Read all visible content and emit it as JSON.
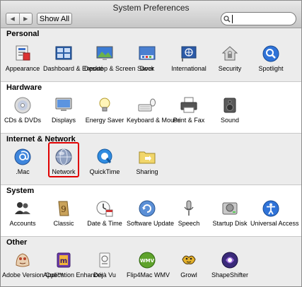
{
  "window": {
    "title": "System Preferences"
  },
  "toolbar": {
    "back_icon": "back-arrow-icon",
    "forward_icon": "forward-arrow-icon",
    "show_all_label": "Show All",
    "search_placeholder": ""
  },
  "sections": [
    {
      "title": "Personal",
      "items": [
        {
          "label": "Appearance",
          "icon": "appearance-icon"
        },
        {
          "label": "Dashboard & Exposé",
          "icon": "dashboard-icon"
        },
        {
          "label": "Desktop & Screen Saver",
          "icon": "desktop-icon"
        },
        {
          "label": "Dock",
          "icon": "dock-icon"
        },
        {
          "label": "International",
          "icon": "globe-flag-icon"
        },
        {
          "label": "Security",
          "icon": "house-lock-icon"
        },
        {
          "label": "Spotlight",
          "icon": "magnifier-icon"
        }
      ]
    },
    {
      "title": "Hardware",
      "items": [
        {
          "label": "CDs & DVDs",
          "icon": "disc-icon"
        },
        {
          "label": "Displays",
          "icon": "monitor-icon"
        },
        {
          "label": "Energy Saver",
          "icon": "lightbulb-icon"
        },
        {
          "label": "Keyboard & Mouse",
          "icon": "keyboard-icon"
        },
        {
          "label": "Print & Fax",
          "icon": "printer-icon"
        },
        {
          "label": "Sound",
          "icon": "speaker-icon"
        }
      ]
    },
    {
      "title": "Internet & Network",
      "items": [
        {
          "label": ".Mac",
          "icon": "mac-at-icon"
        },
        {
          "label": "Network",
          "icon": "network-globe-icon"
        },
        {
          "label": "QuickTime",
          "icon": "quicktime-icon"
        },
        {
          "label": "Sharing",
          "icon": "sharing-folder-icon"
        }
      ]
    },
    {
      "title": "System",
      "items": [
        {
          "label": "Accounts",
          "icon": "accounts-icon"
        },
        {
          "label": "Classic",
          "icon": "classic-icon"
        },
        {
          "label": "Date & Time",
          "icon": "clock-icon"
        },
        {
          "label": "Software Update",
          "icon": "update-icon"
        },
        {
          "label": "Speech",
          "icon": "microphone-icon"
        },
        {
          "label": "Startup Disk",
          "icon": "disk-icon"
        },
        {
          "label": "Universal Access",
          "icon": "universal-access-icon"
        }
      ]
    },
    {
      "title": "Other",
      "items": [
        {
          "label": "Adobe Version Cue™",
          "icon": "adobe-icon"
        },
        {
          "label": "Application Enhancer",
          "icon": "app-enhancer-icon"
        },
        {
          "label": "Déjà Vu",
          "icon": "dejavu-icon"
        },
        {
          "label": "Flip4Mac WMV",
          "icon": "wmv-icon"
        },
        {
          "label": "Growl",
          "icon": "growl-icon"
        },
        {
          "label": "ShapeShifter",
          "icon": "shapeshifter-icon"
        }
      ]
    }
  ],
  "highlighted_item": "Network",
  "colors": {
    "highlight": "#e00000",
    "section_alt": "#ececec"
  }
}
